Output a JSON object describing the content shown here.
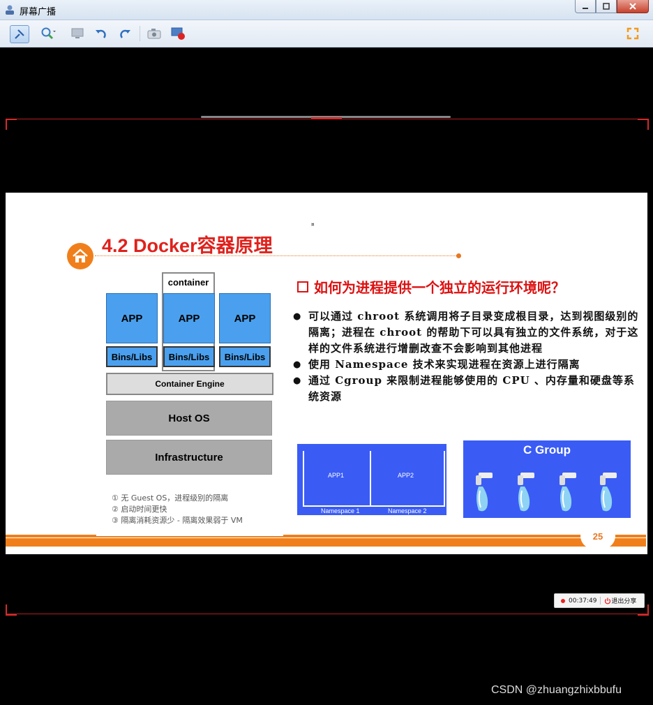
{
  "window": {
    "title": "屏幕广播"
  },
  "toolbar": {
    "buttons": [
      "pin-icon",
      "magnifier-icon",
      "monitor-icon",
      "undo-icon",
      "redo-icon",
      "camera-icon",
      "record-icon",
      "fullscreen-icon"
    ]
  },
  "slide": {
    "title": "4.2 Docker容器原理",
    "diagram": {
      "container_label": "container",
      "apps": [
        "APP",
        "APP",
        "APP"
      ],
      "bins": [
        "Bins/Libs",
        "Bins/Libs",
        "Bins/Libs"
      ],
      "engine": "Container Engine",
      "host_os": "Host OS",
      "infrastructure": "Infrastructure"
    },
    "notes": [
      "① 无 Guest OS，进程级别的隔离",
      "② 启动时间更快",
      "③ 隔离消耗资源少 - 隔离效果弱于 VM"
    ],
    "question": "如何为进程提供一个独立的运行环境呢？",
    "bullets": [
      "可以通过 chroot 系统调用将子目录变成根目录，达到视图级别的隔离；进程在 chroot 的帮助下可以具有独立的文件系统，对于这样的文件系统进行增删改查不会影响到其他进程",
      "使用 Namespace 技术来实现进程在资源上进行隔离",
      "通过 Cgroup 来限制进程能够使用的 CPU 、内存量和硬盘等系统资源"
    ],
    "namespace_image": {
      "apps": [
        "APP1",
        "APP2"
      ],
      "labels": [
        "Namespace 1",
        "Namespace 2"
      ]
    },
    "cgroup_image": {
      "title": "C Group"
    },
    "page_number": "25"
  },
  "recording": {
    "time": "00:37:49",
    "exit_label": "退出分享"
  },
  "watermark": "CSDN @zhuangzhixbbufu",
  "colors": {
    "accent_orange": "#f07f1b",
    "title_red": "#e0211c",
    "app_blue": "#4aa0ee",
    "image_blue": "#3a5cf5"
  }
}
